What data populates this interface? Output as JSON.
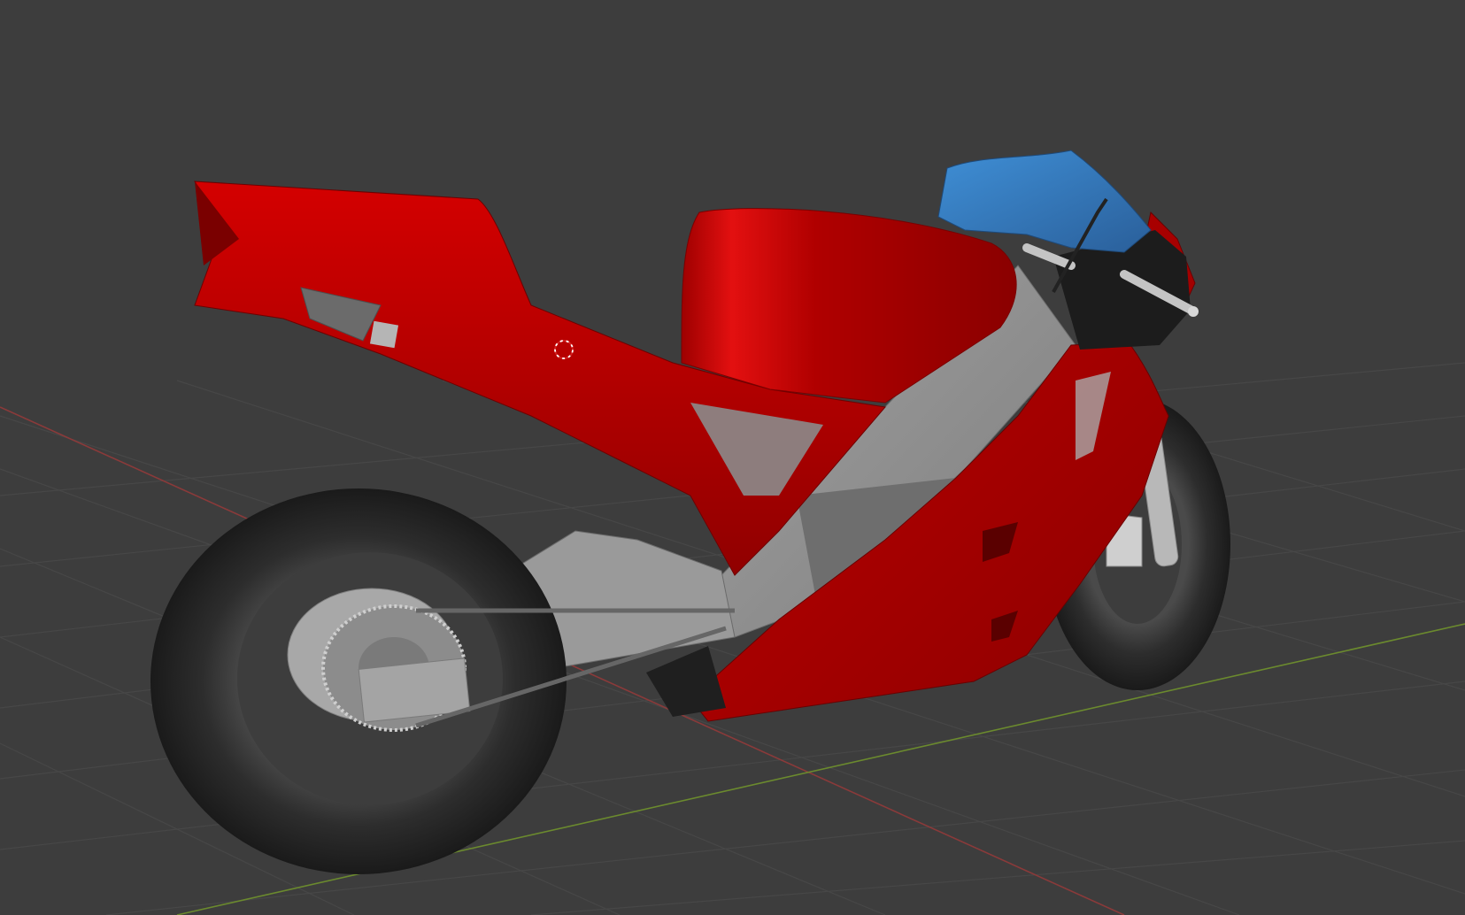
{
  "app": {
    "name": "",
    "view": "3D Viewport"
  },
  "viewport": {
    "background_color": "#3d3d3d",
    "grid_color": "#4a4a4a",
    "x_axis_color": "#8a3a3a",
    "y_axis_color": "#6b8a2e",
    "shading": "solid",
    "object": "motorcycle",
    "object_colors": {
      "fairing": "#c00000",
      "windscreen": "#3a7fc0",
      "frame": "#8c8c8c",
      "tire": "#2a2a2a",
      "wheel_hub": "#a8a8a8"
    },
    "cursor_icon": "3d-cursor-icon"
  }
}
